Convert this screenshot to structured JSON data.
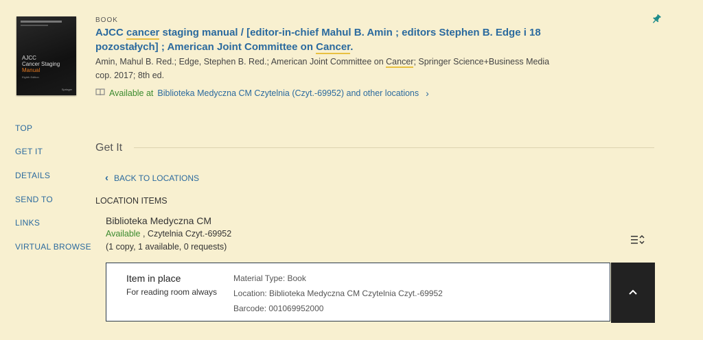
{
  "record": {
    "type_label": "BOOK",
    "title_parts": [
      "AJCC ",
      "cancer",
      " staging manual / [editor-in-chief Mahul B. Amin ; editors Stephen B. Edge i 18 pozostałych] ; American Joint Committee on ",
      "Cancer",
      "."
    ],
    "authors_parts": [
      "Amin, Mahul B. Red.; Edge, Stephen B. Red.; American Joint Committee on ",
      "Cancer",
      "; Springer Science+Business Media"
    ],
    "edition": "cop. 2017; 8th ed.",
    "availability_status": "Available at",
    "availability_location": "Biblioteka Medyczna CM  Czytelnia (Czyt.-69952) and other locations",
    "cover": {
      "title_line1": "AJCC",
      "title_line2": "Cancer Staging",
      "title_line3": "Manual",
      "edition_small": "Eighth Edition",
      "publisher_small": "Springer"
    }
  },
  "nav": {
    "items": [
      "TOP",
      "GET IT",
      "DETAILS",
      "SEND TO",
      "LINKS",
      "VIRTUAL BROWSE"
    ]
  },
  "get_it": {
    "section_title": "Get It",
    "back_label": "BACK TO LOCATIONS",
    "location_items_label": "LOCATION ITEMS",
    "library_name": "Biblioteka Medyczna CM",
    "status_available": "Available",
    "status_location": " , Czytelnia Czyt.-69952",
    "copies": "(1 copy, 1 available, 0 requests)",
    "item": {
      "status": "Item in place",
      "policy": "For reading room always",
      "material_type": "Material Type: Book",
      "location": "Location: Biblioteka Medyczna CM Czytelnia Czyt.-69952",
      "barcode": "Barcode: 001069952000"
    }
  },
  "colors": {
    "background": "#f8f0d0",
    "link": "#2b6a9e",
    "available": "#3b8a2e",
    "pin": "#1a8a8a"
  },
  "icons": {
    "pin": "pin-icon",
    "book": "book-icon",
    "filter": "sort-filter-icon",
    "collapse": "chevron-up-icon",
    "back": "chevron-left-icon"
  }
}
